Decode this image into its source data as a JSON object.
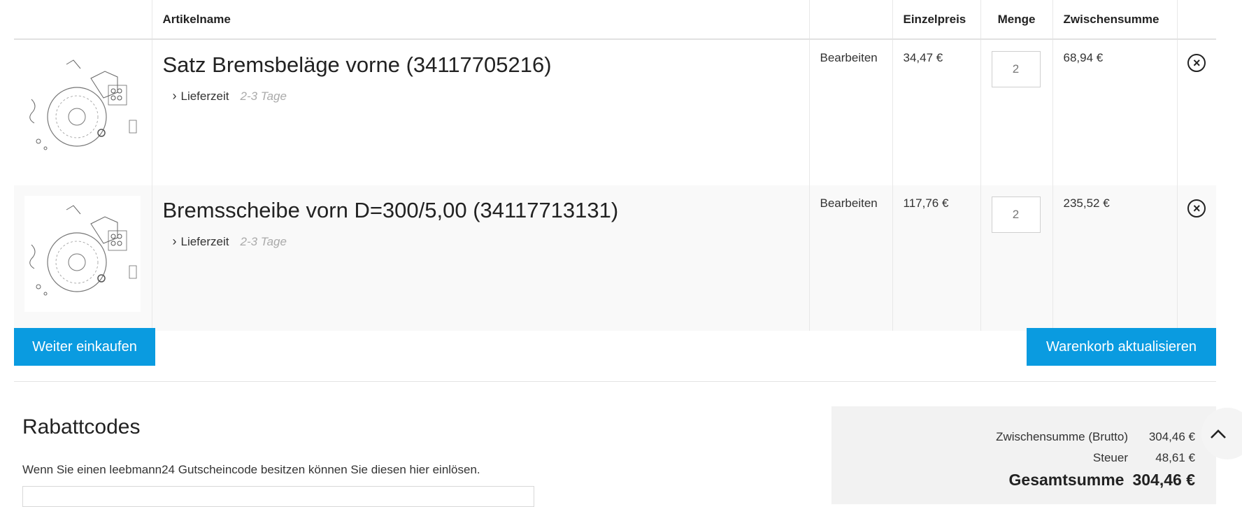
{
  "table": {
    "headers": {
      "name": "Artikelname",
      "edit": "",
      "unit_price": "Einzelpreis",
      "quantity": "Menge",
      "subtotal": "Zwischensumme"
    },
    "rows": [
      {
        "title": "Satz Bremsbeläge vorne (34117705216)",
        "delivery_label": "Lieferzeit",
        "delivery_value": "2-3 Tage",
        "edit_label": "Bearbeiten",
        "unit_price": "34,47 €",
        "quantity": "2",
        "subtotal": "68,94 €"
      },
      {
        "title": "Bremsscheibe vorn D=300/5,00 (34117713131)",
        "delivery_label": "Lieferzeit",
        "delivery_value": "2-3 Tage",
        "edit_label": "Bearbeiten",
        "unit_price": "117,76 €",
        "quantity": "2",
        "subtotal": "235,52 €"
      }
    ],
    "remove_icon": "close-circle-icon",
    "chevron_icon": "chevron-right-icon"
  },
  "actions": {
    "continue_label": "Weiter einkaufen",
    "update_label": "Warenkorb aktualisieren"
  },
  "coupon": {
    "title": "Rabattcodes",
    "description": "Wenn Sie einen leebmann24 Gutscheincode besitzen können Sie diesen hier einlösen."
  },
  "summary": {
    "subtotal_label": "Zwischensumme (Brutto)",
    "subtotal_value": "304,46 €",
    "tax_label": "Steuer",
    "tax_value": "48,61 €",
    "total_label": "Gesamtsumme",
    "total_value": "304,46 €"
  },
  "colors": {
    "accent": "#0a9be0",
    "alt_row": "#f9f9f9",
    "summary_bg": "#f2f2f2"
  }
}
